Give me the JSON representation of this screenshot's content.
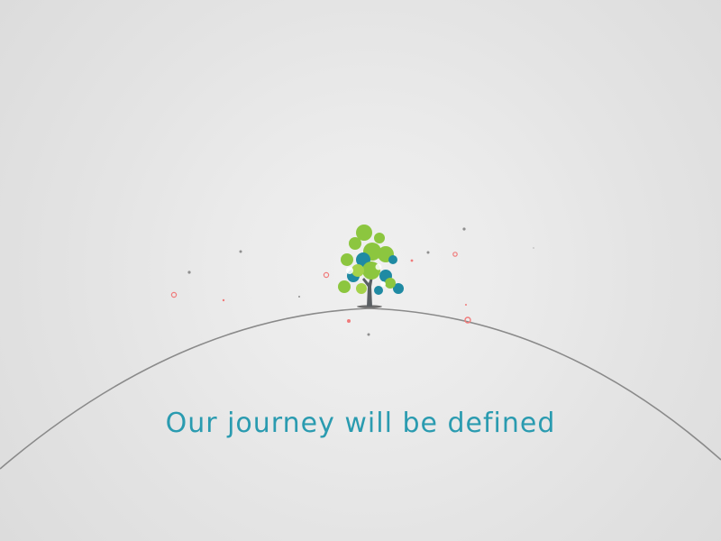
{
  "caption": "Our journey will be defined",
  "colors": {
    "caption": "#2a9bb0",
    "horizon": "#8a8a8a",
    "trunk": "#5a5f63",
    "leaf_green": "#8cc63f",
    "leaf_light": "#a5d24a",
    "leaf_blue": "#1f8aa3",
    "spark_red": "#f07a7a",
    "spark_gray": "#8f8f8f"
  },
  "icons": {
    "tree": "tree-icon"
  }
}
